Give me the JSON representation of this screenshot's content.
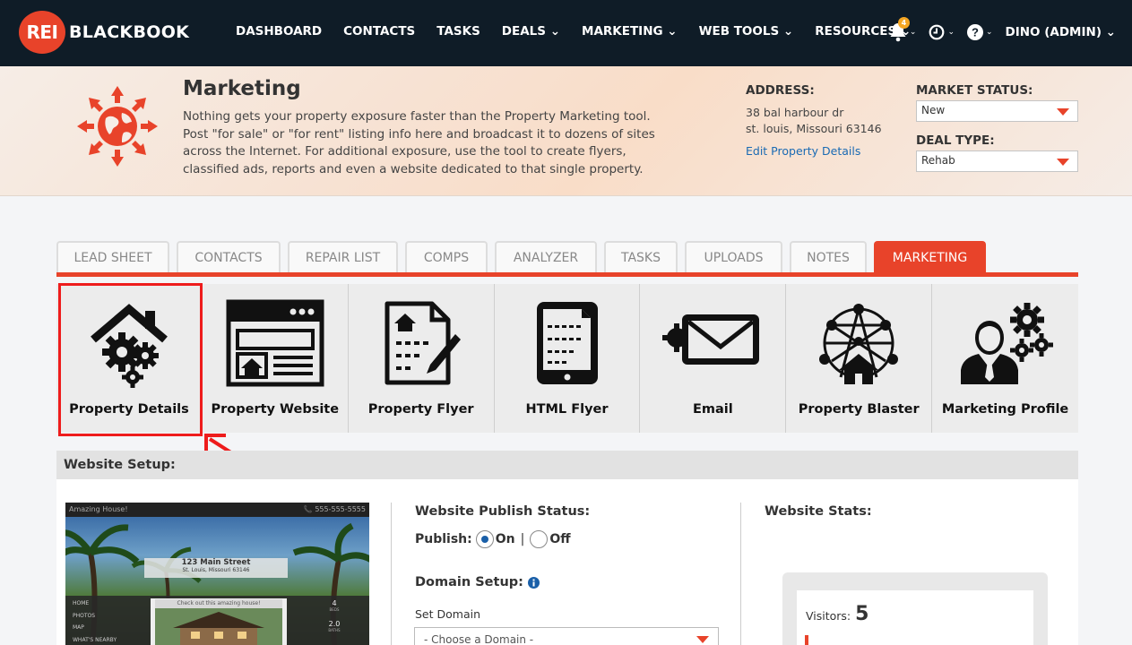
{
  "brand": {
    "badge": "REI",
    "name": "BLACKBOOK"
  },
  "nav": {
    "items": [
      {
        "label": "DASHBOARD"
      },
      {
        "label": "CONTACTS"
      },
      {
        "label": "TASKS"
      },
      {
        "label": "DEALS ⌄"
      },
      {
        "label": "MARKETING ⌄"
      },
      {
        "label": "WEB TOOLS ⌄"
      },
      {
        "label": "RESOURCES ⌄"
      }
    ],
    "notifications_count": "4",
    "user": "DINO (ADMIN) ⌄"
  },
  "hero": {
    "title": "Marketing",
    "description": "Nothing gets your property exposure faster than the Property Marketing tool. Post \"for sale\" or \"for rent\" listing info here and broadcast it to dozens of sites across the Internet. For additional exposure, use the tool to create flyers, classified ads, reports and even a website dedicated to that single property.",
    "address_label": "ADDRESS:",
    "address_line1": "38 bal harbour dr",
    "address_line2": "st. louis, Missouri 63146",
    "edit_link": "Edit Property Details",
    "market_status_label": "MARKET STATUS:",
    "market_status_value": "New",
    "deal_type_label": "DEAL TYPE:",
    "deal_type_value": "Rehab"
  },
  "tabs": [
    {
      "label": "LEAD SHEET"
    },
    {
      "label": "CONTACTS"
    },
    {
      "label": "REPAIR LIST"
    },
    {
      "label": "COMPS"
    },
    {
      "label": "ANALYZER"
    },
    {
      "label": "TASKS"
    },
    {
      "label": "UPLOADS"
    },
    {
      "label": "NOTES"
    },
    {
      "label": "MARKETING"
    }
  ],
  "active_tab": "MARKETING",
  "tools": [
    {
      "label": "Property Details",
      "icon": "house-gears-icon"
    },
    {
      "label": "Property Website",
      "icon": "website-icon"
    },
    {
      "label": "Property Flyer",
      "icon": "flyer-icon"
    },
    {
      "label": "HTML Flyer",
      "icon": "tablet-icon"
    },
    {
      "label": "Email",
      "icon": "envelope-icon"
    },
    {
      "label": "Property Blaster",
      "icon": "network-house-icon"
    },
    {
      "label": "Marketing Profile",
      "icon": "person-gears-icon"
    }
  ],
  "website_setup": {
    "title": "Website Setup:",
    "preview": {
      "site_title": "Amazing House!",
      "phone": "📞 555-555-5555",
      "street": "123 Main Street",
      "city": "St. Louis, Missouri 63146",
      "caption": "Check out this amazing house!",
      "menu": [
        "HOME",
        "PHOTOS",
        "MAP",
        "WHAT'S NEARBY"
      ],
      "beds": "4",
      "beds_label": "BEDS",
      "baths": "2.0",
      "baths_label": "BATHS"
    },
    "publish_status_title": "Website Publish Status:",
    "publish_label": "Publish:",
    "on_label": "On",
    "separator": "|",
    "off_label": "Off",
    "domain_title": "Domain Setup:",
    "set_domain_label": "Set Domain",
    "domain_placeholder": "- Choose a Domain -",
    "stats_title": "Website Stats:",
    "visitors_label": "Visitors:",
    "visitors_value": "5"
  },
  "colors": {
    "accent": "#e8432a",
    "nav_bg": "#0f1c27",
    "link": "#1a6ab3",
    "highlight": "#ee1c1c"
  }
}
